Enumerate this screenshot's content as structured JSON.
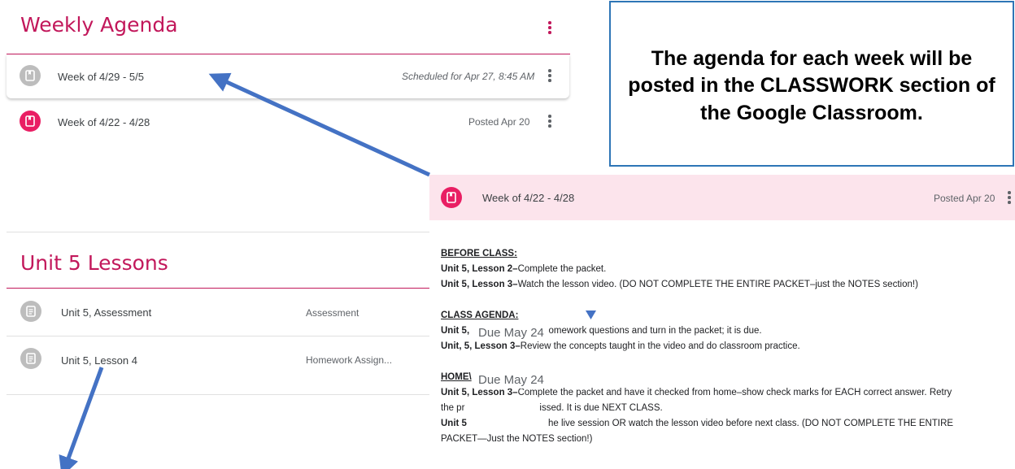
{
  "weekly_agenda": {
    "title": "Weekly Agenda",
    "items": [
      {
        "label": "Week of 4/29 - 5/5",
        "meta": "Scheduled for Apr 27, 8:45 AM",
        "icon": "assignment-icon"
      },
      {
        "label": "Week of 4/22 - 4/28",
        "meta": "Posted Apr 20",
        "icon": "assignment-icon"
      }
    ]
  },
  "unit_lessons": {
    "title": "Unit 5 Lessons",
    "items": [
      {
        "label": "Unit 5, Assessment",
        "type": "Assessment",
        "icon": "material-icon"
      },
      {
        "label": "Unit 5, Lesson 4",
        "type": "Homework Assign...",
        "icon": "material-icon"
      }
    ]
  },
  "callout": {
    "text": "The agenda for each week will be posted in the CLASSWORK section of the Google Classroom."
  },
  "card": {
    "title": "Week of 4/22 - 4/28",
    "meta": "Posted Apr 20",
    "before_heading": "BEFORE CLASS:",
    "before_1_bold": "Unit 5, Lesson 2–",
    "before_1_text": "Complete the packet.",
    "before_2_bold": "Unit 5, Lesson 3–",
    "before_2_text": "Watch the lesson video. (DO NOT COMPLETE THE ENTIRE PACKET–just the NOTES section!)",
    "class_heading": "CLASS AGENDA:",
    "class_1_bold": "Unit 5,",
    "class_1_text": "homework questions and turn in the packet; it is due.",
    "class_2_bold": "Unit, 5, Lesson 3–",
    "class_2_text": "Review the concepts taught in the video and do classroom practice.",
    "home_heading": "HOME\\",
    "home_1_bold": "Unit 5, Lesson 3–",
    "home_1_text": "Complete the packet and have it checked from home–show check marks for EACH correct answer. Retry",
    "home_2_text": "the pr",
    "home_2_rest": "issed. It is due NEXT CLASS.",
    "home_3_bold": "Unit 5",
    "home_3_text": "he live session OR watch the lesson video before next class. (DO NOT COMPLETE THE ENTIRE",
    "home_4_text": "PACKET—Just the NOTES section!)",
    "due_1": "Due May 24",
    "due_2": "Due May 24"
  },
  "colors": {
    "accent": "#c2185b",
    "pink_icon": "#e91e63",
    "card_header": "#fce4ec",
    "arrow": "#4472c4",
    "callout_border": "#2e75b6"
  }
}
